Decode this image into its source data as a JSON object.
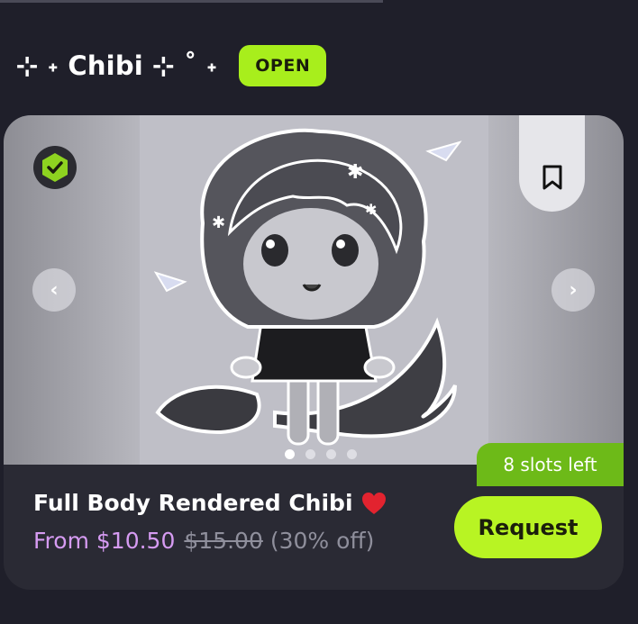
{
  "header": {
    "title": "⊹ ˖ Chibi ⊹ ˚ ˖",
    "status_badge": "OPEN"
  },
  "listing": {
    "title": "Full Body Rendered Chibi",
    "price_label": "From $10.50",
    "original_price": "$15.00",
    "discount": "(30% off)",
    "slots_left": "8 slots left",
    "request_label": "Request",
    "gallery_image_count": 4,
    "gallery_active_index": 0
  },
  "icons": {
    "verified": "check-badge-icon",
    "bookmark": "bookmark-icon",
    "prev": "chevron-left-icon",
    "next": "chevron-right-icon",
    "heart": "heart-icon"
  },
  "colors": {
    "background": "#1f1f2a",
    "card": "#2a2a34",
    "accent_green": "#b8f423",
    "slots_green": "#6dba18",
    "price_purple": "#d69bf2",
    "muted": "#8f8f9c",
    "heart": "#e2232f"
  }
}
